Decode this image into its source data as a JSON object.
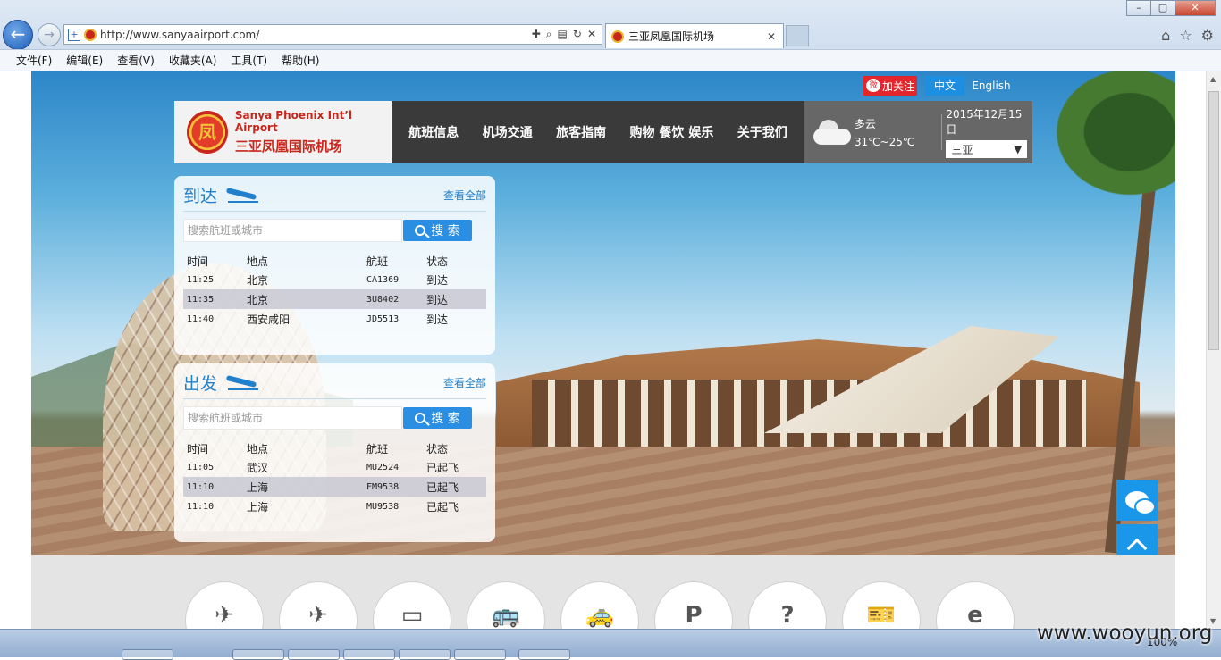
{
  "browser": {
    "url": "http://www.sanyaairport.com/",
    "tab_title": "三亚凤凰国际机场",
    "menu": [
      "文件(F)",
      "编辑(E)",
      "查看(V)",
      "收藏夹(A)",
      "工具(T)",
      "帮助(H)"
    ],
    "zoom": "100%"
  },
  "header": {
    "weibo_label": "加关注",
    "lang_cn": "中文",
    "lang_en": "English",
    "logo_en": "Sanya Phoenix Int’l Airport",
    "logo_cn": "三亚凤凰国际机场",
    "nav": [
      "航班信息",
      "机场交通",
      "旅客指南",
      "购物 餐饮 娱乐",
      "关于我们"
    ],
    "weather_cond": "多云",
    "weather_temp": "31℃~25℃",
    "date": "2015年12月15日",
    "city": "三亚"
  },
  "arrivals": {
    "title": "到达",
    "view_all": "查看全部",
    "search_placeholder": "搜索航班或城市",
    "search_button": "搜 索",
    "columns": [
      "时间",
      "地点",
      "航班",
      "状态"
    ],
    "rows": [
      [
        "11:25",
        "北京",
        "CA1369",
        "到达"
      ],
      [
        "11:35",
        "北京",
        "3U8402",
        "到达"
      ],
      [
        "11:40",
        "西安咸阳",
        "JD5513",
        "到达"
      ]
    ]
  },
  "departures": {
    "title": "出发",
    "view_all": "查看全部",
    "search_placeholder": "搜索航班或城市",
    "search_button": "搜 索",
    "columns": [
      "时间",
      "地点",
      "航班",
      "状态"
    ],
    "rows": [
      [
        "11:05",
        "武汉",
        "MU2524",
        "已起飞"
      ],
      [
        "11:10",
        "上海",
        "FM9538",
        "已起飞"
      ],
      [
        "11:10",
        "上海",
        "MU9538",
        "已起飞"
      ]
    ]
  },
  "services_icons": [
    "arrival-plane-icon",
    "departure-plane-icon",
    "screen-icon",
    "bus-icon",
    "taxi-icon",
    "parking-icon",
    "luggage-icon",
    "ticket-icon",
    "ie-icon"
  ],
  "services_glyphs": [
    "✈",
    "✈",
    "▭",
    "🚌",
    "🚕",
    "P",
    "?",
    "🎫",
    "e"
  ],
  "watermark": "www.wooyun.org",
  "colors": {
    "accent": "#1e8ee0",
    "brand_red": "#c9261b",
    "nav_bg": "#3a3a3a"
  }
}
